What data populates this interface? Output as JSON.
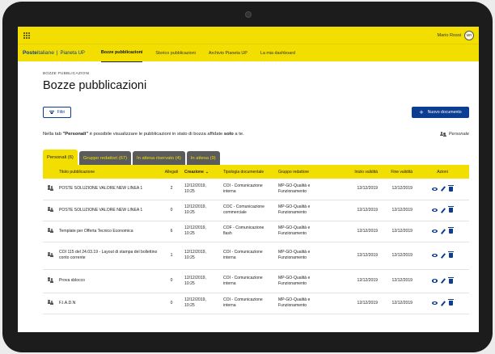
{
  "header": {
    "user_name": "Mario Rossi",
    "user_initials": "MR",
    "logo_bold": "Poste",
    "logo_light": "italiane",
    "logo_separator": "|",
    "app_name": "Pianeta UP",
    "nav": [
      {
        "label": "Bozze pubblicazioni",
        "active": true
      },
      {
        "label": "Storico pubblicazioni",
        "active": false
      },
      {
        "label": "Archivio Pianeta UP",
        "active": false
      },
      {
        "label": "La mia dashboard",
        "active": false
      }
    ]
  },
  "page": {
    "breadcrumb": "BOZZE PUBBLICAZIONI",
    "title": "Bozze pubblicazioni",
    "filter_label": "Filtri",
    "new_button_label": "Nuovo documento",
    "new_button_icon": "+",
    "info_prefix": "Nella tab ",
    "info_tab": "\"Personali\"",
    "info_middle": " è possibile visualizzare le pubblicazioni in stato di bozza affidate ",
    "info_emph": "solo",
    "info_suffix": " a te.",
    "personal_tag": "Personale"
  },
  "tabs": [
    {
      "label": "Personali (6)",
      "active": true
    },
    {
      "label": "Gruppo redattori  (67)",
      "active": false
    },
    {
      "label": "In attesa riservato (4)",
      "active": false
    },
    {
      "label": "In attesa (9)",
      "active": false
    }
  ],
  "table": {
    "columns": [
      "Titolo pubblicazione",
      "Allegati",
      "Creazione",
      "Tipologia documentale",
      "Gruppo redattore",
      "Inizio validità",
      "Fine validità",
      "Azioni"
    ],
    "sort_indicator": "⌄",
    "rows": [
      {
        "title": "POSTE SOLUZIONE VALORE NEW LINEA 1",
        "attachments": "2",
        "created_date": "12/12/2019,",
        "created_time": "10:25",
        "type_line1": "COI - Comunicazione",
        "type_line2": "interna",
        "group_line1": "MP-GO-Qualità e",
        "group_line2": "Funzionamento",
        "start": "12/12/2019",
        "end": "12/12/2019"
      },
      {
        "title": "POSTE SOLUZIONE VALORE NEW LINEA 1",
        "attachments": "0",
        "created_date": "12/12/2019,",
        "created_time": "10:25",
        "type_line1": "COC - Comunicazione",
        "type_line2": "commerciale",
        "group_line1": "MP-GO-Qualità e",
        "group_line2": "Funzionamento",
        "start": "12/12/2019",
        "end": "12/12/2019"
      },
      {
        "title": "Template per Offerta Tecnico Economica",
        "attachments": "6",
        "created_date": "12/12/2019,",
        "created_time": "10:25",
        "type_line1": "COF - Comunicazione",
        "type_line2": "flash",
        "group_line1": "MP-GO-Qualità e",
        "group_line2": "Funzionamento",
        "start": "12/12/2019",
        "end": "12/12/2019"
      },
      {
        "title": "COI 115 del 24.03.19 - Layout di stampa del bollettino conto corrente",
        "attachments": "1",
        "created_date": "12/12/2019,",
        "created_time": "10:25",
        "type_line1": "COI - Comunicazione",
        "type_line2": "interna",
        "group_line1": "MP-GO-Qualità e",
        "group_line2": "Funzionamento",
        "start": "12/12/2019",
        "end": "12/12/2019"
      },
      {
        "title": "Prova sblocco",
        "attachments": "0",
        "created_date": "12/12/2019,",
        "created_time": "10:25",
        "type_line1": "COI - Comunicazione",
        "type_line2": "interna",
        "group_line1": "MP-GO-Qualità e",
        "group_line2": "Funzionamento",
        "start": "12/12/2019",
        "end": "12/12/2019"
      },
      {
        "title": "F.I.A.D.N",
        "attachments": "0",
        "created_date": "12/12/2019,",
        "created_time": "10:25",
        "type_line1": "COI - Comunicazione",
        "type_line2": "interna",
        "group_line1": "MP-GO-Qualità e",
        "group_line2": "Funzionamento",
        "start": "12/12/2019",
        "end": "12/12/2019"
      }
    ]
  },
  "colors": {
    "brand_yellow": "#f2de00",
    "brand_blue": "#0b3d91",
    "tab_inactive": "#5b5b5b"
  },
  "icons": {
    "apps": "apps-grid-icon",
    "filter": "filter-icon",
    "add": "plus-icon",
    "owner": "people-icon",
    "view": "eye-icon",
    "edit": "pencil-icon",
    "delete": "trash-icon"
  }
}
